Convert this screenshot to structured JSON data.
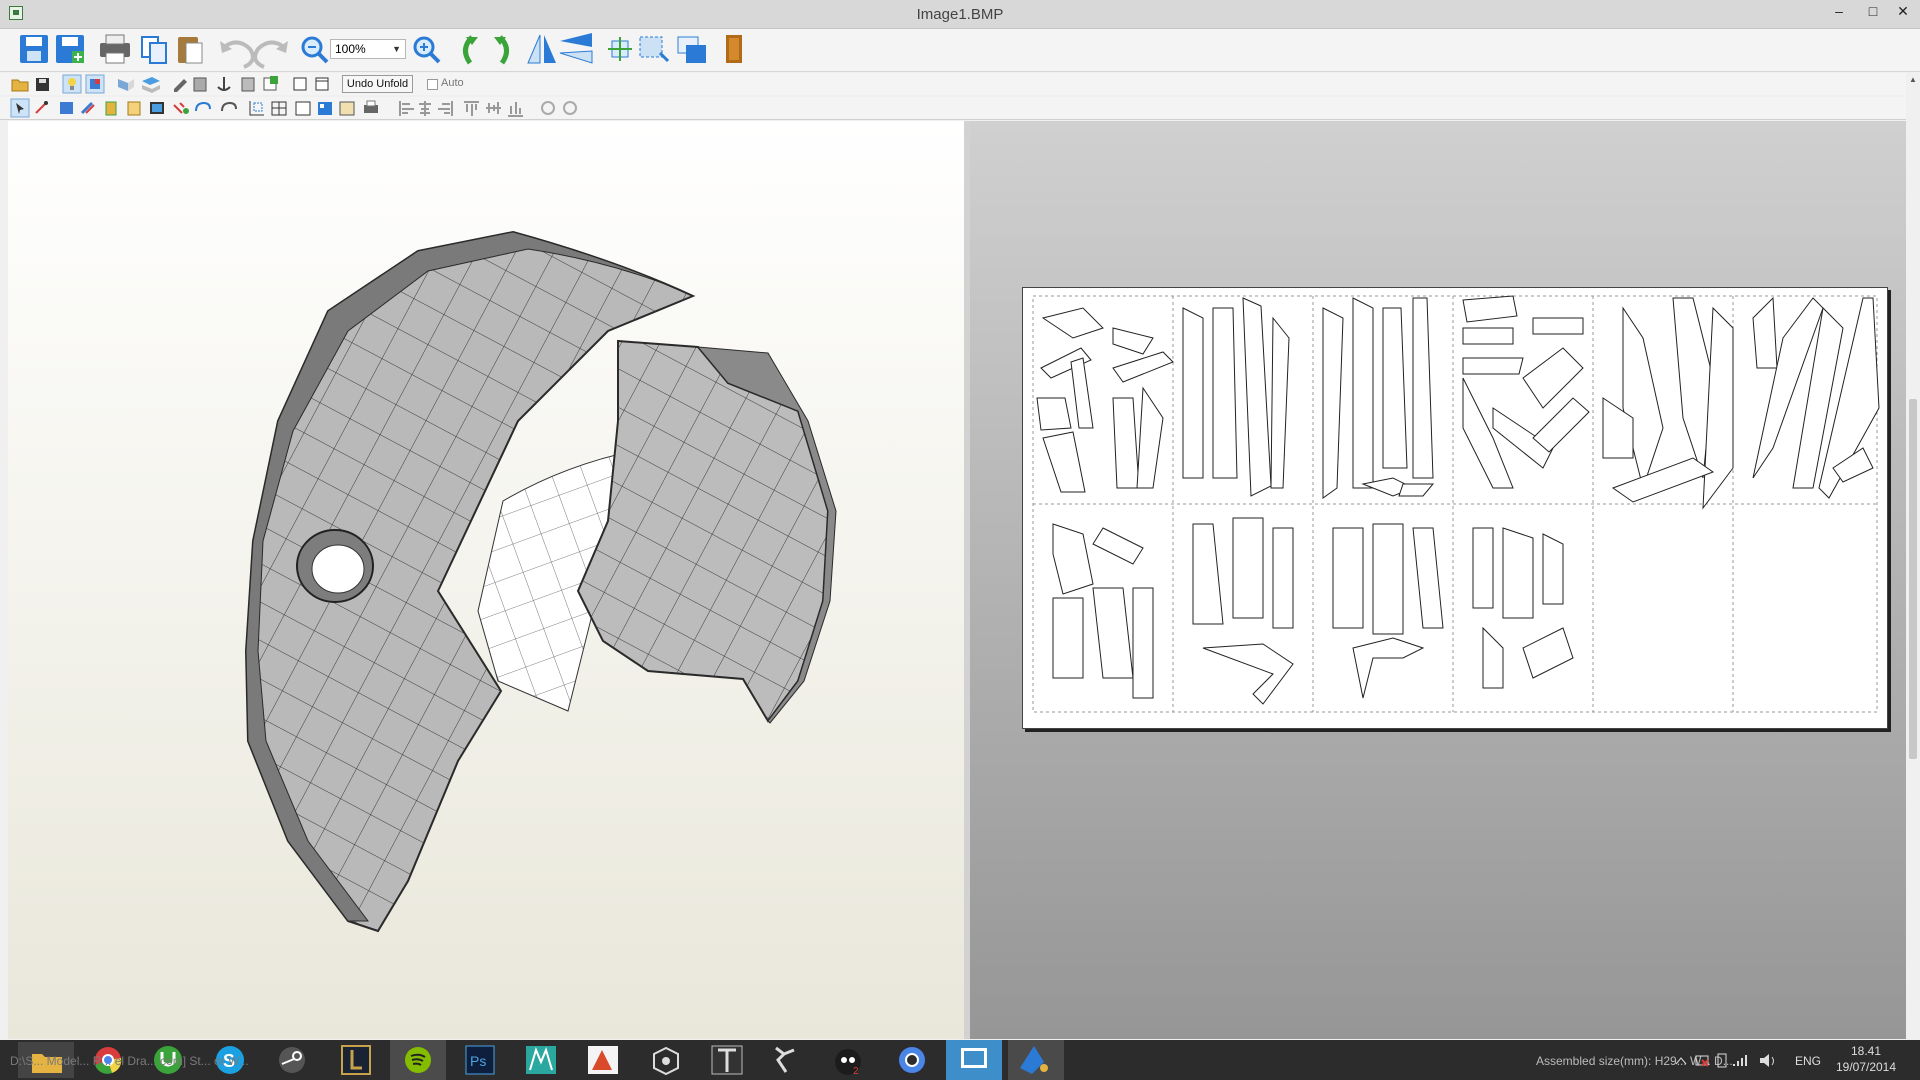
{
  "window": {
    "title": "Image1.BMP",
    "controls": {
      "minimize": "–",
      "maximize": "□",
      "close": "✕"
    }
  },
  "toolbar_main": {
    "zoom_value": "100%",
    "icons": [
      "save-icon",
      "save-as-icon",
      "print-icon",
      "copy-icon",
      "paste-icon",
      "undo-icon",
      "redo-icon",
      "zoom-out-icon",
      "zoom-in-icon",
      "rotate-left-icon",
      "rotate-right-icon",
      "flip-horizontal-icon",
      "flip-vertical-icon",
      "fit-icon",
      "select-area-icon",
      "layers-icon",
      "door-icon"
    ]
  },
  "toolbar_edit": {
    "undo_unfold_label": "Undo Unfold",
    "auto_label": "Auto"
  },
  "status": {
    "faded_text": "D:\\S... Model... R... el Dra... com] St... or W...",
    "assembled_size": "Assembled size(mm): H29... W... D...",
    "language": "ENG",
    "time": "18.41",
    "date": "19/07/2014"
  },
  "taskbar": {
    "apps": [
      "file-explorer-icon",
      "chrome-icon",
      "utorrent-icon",
      "skype-icon",
      "steam-icon",
      "league-of-legends-icon",
      "spotify-icon",
      "photoshop-icon",
      "maya-icon",
      "mudbox-icon",
      "unity-icon",
      "pepakura-icon",
      "zbrush-icon",
      "game-icon",
      "chromium-icon",
      "pepakura-viewer-icon",
      "cloud-app-icon"
    ]
  },
  "colors": {
    "titlebar_bg": "#d8d8d8",
    "taskbar_bg": "#2c2c2c",
    "model_face": "#b8b8b8",
    "paper_bg": "#ffffff",
    "right_pane_gradient_top": "#d0d0d0",
    "right_pane_gradient_bottom": "#969696"
  },
  "sheet": {
    "columns": 6,
    "rows": 2
  }
}
